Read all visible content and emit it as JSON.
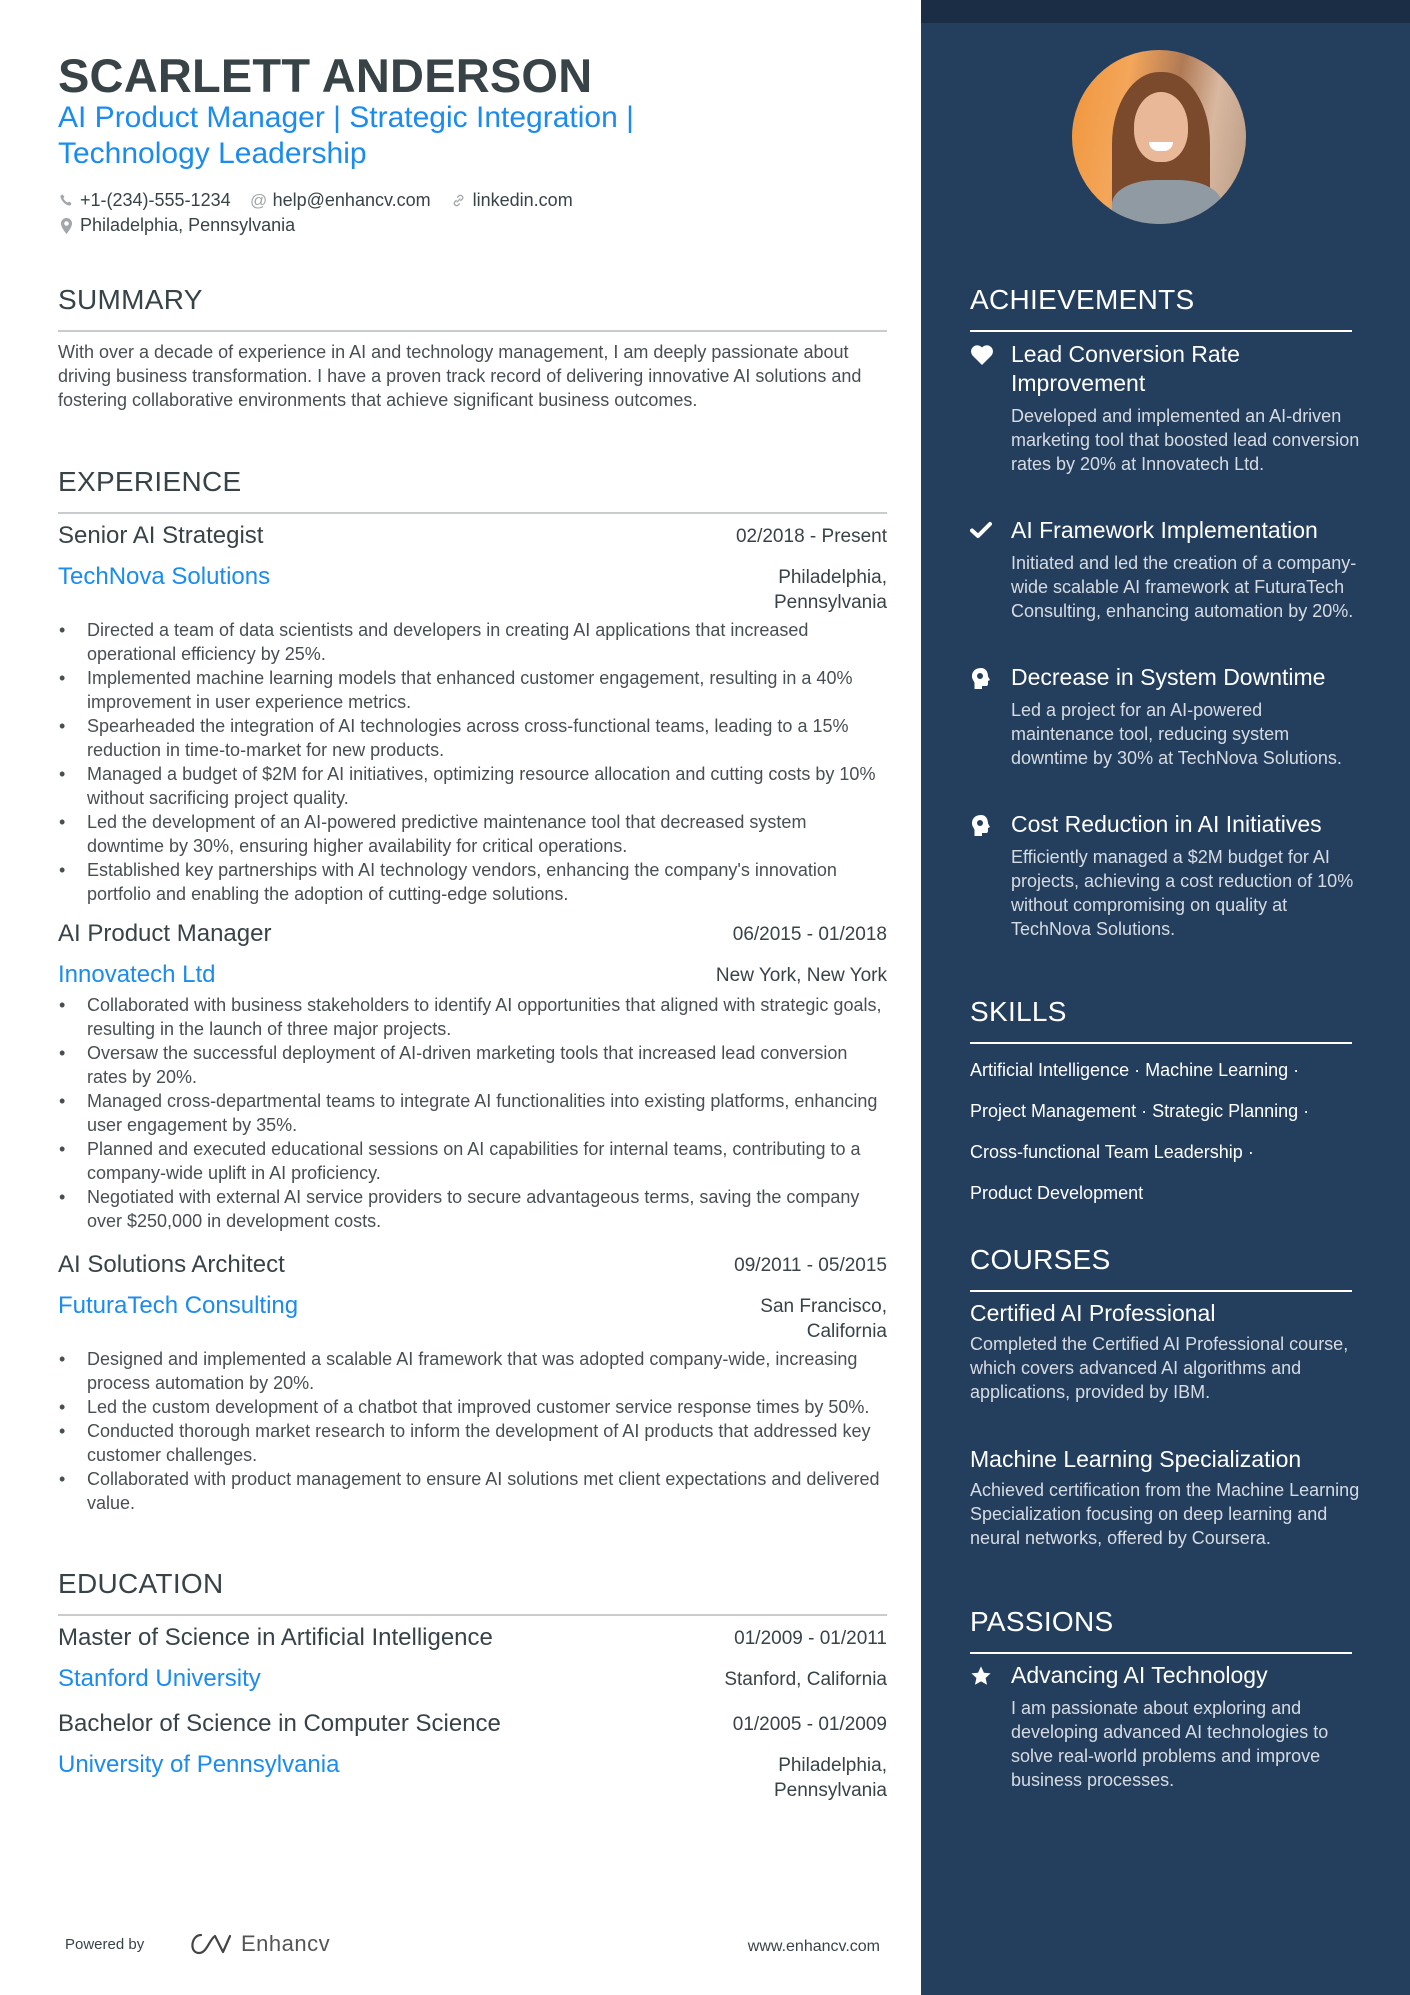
{
  "header": {
    "name": "SCARLETT ANDERSON",
    "title": "AI Product Manager | Strategic Integration | Technology Leadership",
    "contacts": {
      "phone": "+1-(234)-555-1234",
      "email": "help@enhancv.com",
      "link": "linkedin.com",
      "location": "Philadelphia, Pennsylvania"
    },
    "icons": [
      "phone-icon",
      "at-icon",
      "link-icon",
      "location-pin-icon"
    ]
  },
  "summary": {
    "heading": "SUMMARY",
    "text": "With over a decade of experience in AI and technology management, I am deeply passionate about driving business transformation. I have a proven track record of delivering innovative AI solutions and fostering collaborative environments that achieve significant business outcomes."
  },
  "experience": {
    "heading": "EXPERIENCE",
    "jobs": [
      {
        "title": "Senior AI Strategist",
        "dates": "02/2018 - Present",
        "company": "TechNova Solutions",
        "location": "Philadelphia, Pennsylvania",
        "bullets": [
          "Directed a team of data scientists and developers in creating AI applications that increased operational efficiency by 25%.",
          "Implemented machine learning models that enhanced customer engagement, resulting in a 40% improvement in user experience metrics.",
          "Spearheaded the integration of AI technologies across cross-functional teams, leading to a 15% reduction in time-to-market for new products.",
          "Managed a budget of $2M for AI initiatives, optimizing resource allocation and cutting costs by 10% without sacrificing project quality.",
          "Led the development of an AI-powered predictive maintenance tool that decreased system downtime by 30%, ensuring higher availability for critical operations.",
          "Established key partnerships with AI technology vendors, enhancing the company's innovation portfolio and enabling the adoption of cutting-edge solutions."
        ]
      },
      {
        "title": "AI Product Manager",
        "dates": "06/2015 - 01/2018",
        "company": "Innovatech Ltd",
        "location": "New York, New York",
        "bullets": [
          "Collaborated with business stakeholders to identify AI opportunities that aligned with strategic goals, resulting in the launch of three major projects.",
          "Oversaw the successful deployment of AI-driven marketing tools that increased lead conversion rates by 20%.",
          "Managed cross-departmental teams to integrate AI functionalities into existing platforms, enhancing user engagement by 35%.",
          "Planned and executed educational sessions on AI capabilities for internal teams, contributing to a company-wide uplift in AI proficiency.",
          "Negotiated with external AI service providers to secure advantageous terms, saving the company over $250,000 in development costs."
        ]
      },
      {
        "title": "AI Solutions Architect",
        "dates": "09/2011 - 05/2015",
        "company": "FuturaTech Consulting",
        "location": "San Francisco, California",
        "bullets": [
          "Designed and implemented a scalable AI framework that was adopted company-wide, increasing process automation by 20%.",
          "Led the custom development of a chatbot that improved customer service response times by 50%.",
          "Conducted thorough market research to inform the development of AI products that addressed key customer challenges.",
          "Collaborated with product management to ensure AI solutions met client expectations and delivered value."
        ]
      }
    ]
  },
  "education": {
    "heading": "EDUCATION",
    "items": [
      {
        "degree": "Master of Science in Artificial Intelligence",
        "dates": "01/2009 - 01/2011",
        "school": "Stanford University",
        "location": "Stanford, California"
      },
      {
        "degree": "Bachelor of Science in Computer Science",
        "dates": "01/2005 - 01/2009",
        "school": "University of Pennsylvania",
        "location": "Philadelphia, Pennsylvania"
      }
    ]
  },
  "achievements": {
    "heading": "ACHIEVEMENTS",
    "items": [
      {
        "icon": "heart-icon",
        "title": "Lead Conversion Rate Improvement",
        "desc": "Developed and implemented an AI-driven marketing tool that boosted lead conversion rates by 20% at Innovatech Ltd."
      },
      {
        "icon": "check-icon",
        "title": "AI Framework Implementation",
        "desc": "Initiated and led the creation of a company-wide scalable AI framework at FuturaTech Consulting, enhancing automation by 20%."
      },
      {
        "icon": "brain-head-icon",
        "title": "Decrease in System Downtime",
        "desc": "Led a project for an AI-powered maintenance tool, reducing system downtime by 30% at TechNova Solutions."
      },
      {
        "icon": "brain-head-icon",
        "title": "Cost Reduction in AI Initiatives",
        "desc": "Efficiently managed a $2M budget for AI projects, achieving a cost reduction of 10% without compromising on quality at TechNova Solutions."
      }
    ]
  },
  "skills": {
    "heading": "SKILLS",
    "lines": [
      "Artificial Intelligence · Machine Learning ·",
      "Project Management · Strategic Planning ·",
      "Cross-functional Team Leadership ·",
      "Product Development"
    ],
    "items": [
      "Artificial Intelligence",
      "Machine Learning",
      "Project Management",
      "Strategic Planning",
      "Cross-functional Team Leadership",
      "Product Development"
    ]
  },
  "courses": {
    "heading": "COURSES",
    "items": [
      {
        "title": "Certified AI Professional",
        "desc": "Completed the Certified AI Professional course, which covers advanced AI algorithms and applications, provided by IBM."
      },
      {
        "title": "Machine Learning Specialization",
        "desc": "Achieved certification from the Machine Learning Specialization focusing on deep learning and neural networks, offered by Coursera."
      }
    ]
  },
  "passions": {
    "heading": "PASSIONS",
    "items": [
      {
        "icon": "star-icon",
        "title": "Advancing AI Technology",
        "desc": "I am passionate about exploring and developing advanced AI technologies to solve real-world problems and improve business processes."
      }
    ]
  },
  "footer": {
    "powered_by": "Powered by",
    "brand": "Enhancv",
    "website": "www.enhancv.com"
  },
  "colors": {
    "accent": "#1a8cf0",
    "text": "#384347",
    "sidebar": "#243f5e",
    "sidebar_band": "#1b2d45"
  }
}
